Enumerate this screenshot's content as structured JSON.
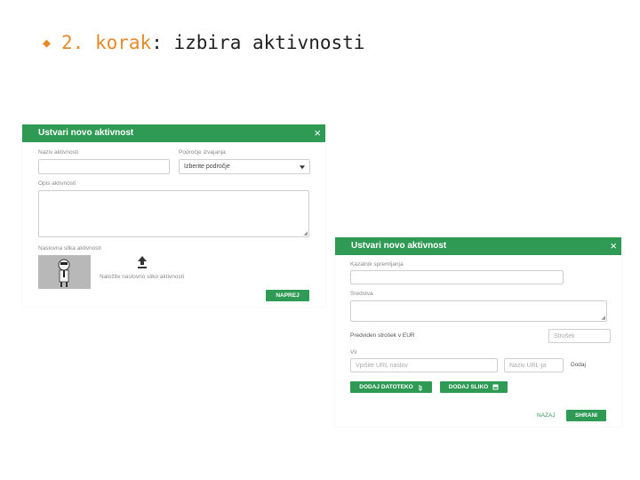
{
  "slide": {
    "step": "2. korak",
    "colon": ":",
    "topic": " izbira aktivnosti"
  },
  "dialog1": {
    "title": "Ustvari novo aktivnost",
    "close": "×",
    "name_label": "Naziv aktivnosti",
    "area_label": "Področje izvajanja",
    "area_value": "Izberite področje",
    "desc_label": "Opis aktivnosti",
    "image_label": "Naslovna slika aktivnosti",
    "upload_text": "Naložite naslovno sliko aktivnosti",
    "next_button": "NAPREJ"
  },
  "dialog2": {
    "title": "Ustvari novo aktivnost",
    "close": "×",
    "indicator_label": "Kazalnik spremljanja",
    "description_label": "Sredstva",
    "cost_label": "Predviden strošek v EUR",
    "cost_placeholder": "Strošek",
    "link_label": "Vir",
    "url_placeholder": "Vpišite URL naslov",
    "url_name_placeholder": "Naziv URL-ja",
    "add_link": "Dodaj",
    "add_file_button": "DODAJ DATOTEKO",
    "add_image_button": "DODAJ SLIKO",
    "back_button": "NAZAJ",
    "save_button": "SHRANI"
  },
  "colors": {
    "accent": "#e48a2b",
    "header_green": "#2e9a53"
  },
  "icons": [
    "diamond-bullet-icon",
    "close-icon",
    "chevron-down-icon",
    "upload-icon",
    "avatar-placeholder-icon",
    "paperclip-icon",
    "image-icon"
  ]
}
